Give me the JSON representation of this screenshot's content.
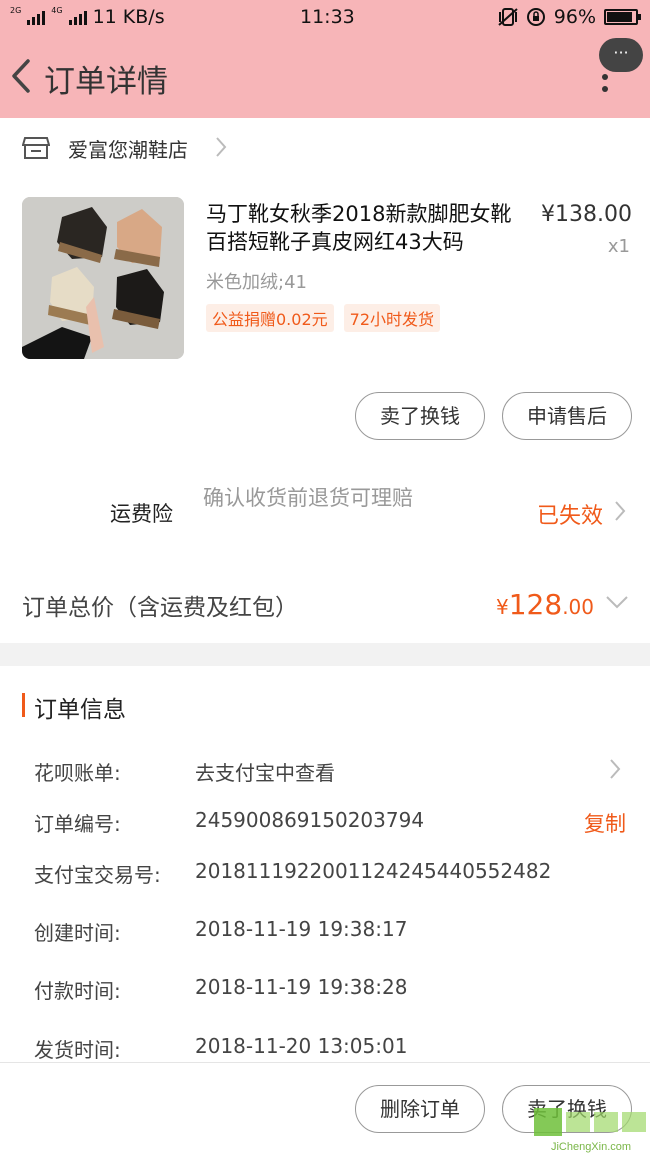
{
  "status_bar": {
    "net_left": "2G",
    "net_right": "4G",
    "speed": "11 KB/s",
    "time": "11:33",
    "battery_percent": "96%",
    "battery_level": 0.96
  },
  "header": {
    "title": "订单详情",
    "more_label": "···"
  },
  "shop": {
    "name": "爱富您潮鞋店"
  },
  "product": {
    "title": "马丁靴女秋季2018新款脚肥女靴百搭短靴子真皮网红43大码",
    "price": "¥138.00",
    "qty": "x1",
    "spec": "米色加绒;41",
    "tags": [
      "公益捐赠0.02元",
      "72小时发货"
    ]
  },
  "actions": {
    "sell": "卖了换钱",
    "after_sale": "申请售后"
  },
  "freight": {
    "label": "运费险",
    "desc": "确认收货前退货可理赔",
    "status": "已失效"
  },
  "total": {
    "label": "订单总价（含运费及红包）",
    "currency": "¥",
    "integer": "128",
    "decimal": ".00"
  },
  "info": {
    "title": "订单信息",
    "rows": [
      {
        "label": "花呗账单:",
        "value": "去支付宝中查看"
      },
      {
        "label": "订单编号:",
        "value": "245900869150203794",
        "action": "复制"
      },
      {
        "label": "支付宝交易号:",
        "value": "2018111922001124245440552482"
      },
      {
        "label": "创建时间:",
        "value": "2018-11-19 19:38:17"
      },
      {
        "label": "付款时间:",
        "value": "2018-11-19 19:38:28"
      },
      {
        "label": "发货时间:",
        "value": "2018-11-20 13:05:01"
      }
    ]
  },
  "footer": {
    "delete": "删除订单",
    "sell": "卖了换钱"
  },
  "watermark": {
    "text": "JiChengXin.com"
  },
  "colors": {
    "header_bg": "#f7b5b8",
    "accent": "#f05a1a",
    "tag_bg": "#fdeee6"
  }
}
